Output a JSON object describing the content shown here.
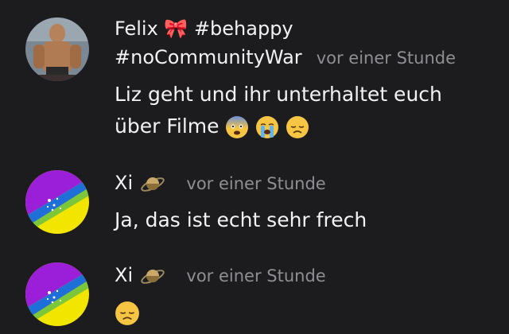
{
  "messages": [
    {
      "author_line1": "Felix 🎀 #behappy",
      "author_line2": "#noCommunityWar",
      "timestamp": "vor einer Stunde",
      "text": "Liz geht und ihr unterhaltet euch über Filme",
      "text_emojis": [
        "😨",
        "😭",
        "😞"
      ]
    },
    {
      "author": "Xi",
      "author_emoji": "🪐",
      "timestamp": "vor einer Stunde",
      "text": "Ja, das ist echt sehr frech"
    },
    {
      "author": "Xi",
      "author_emoji": "🪐",
      "timestamp": "vor einer Stunde",
      "text_emoji": "😞"
    }
  ],
  "colors": {
    "background": "#1c1c1e",
    "text": "#f2f2f4",
    "timestamp": "#8e8e93",
    "avatar_purple": "#9b1fd8",
    "avatar_blue": "#1f6fd8",
    "avatar_green": "#7cc63a",
    "avatar_yellow": "#f2e600"
  }
}
